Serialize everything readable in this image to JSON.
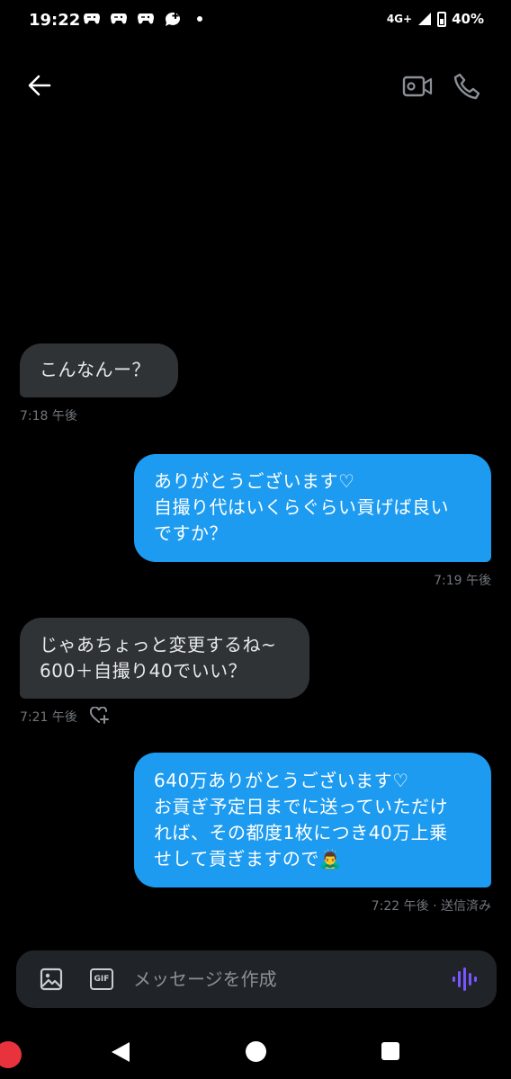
{
  "status_bar": {
    "time": "19:22",
    "network": "4G+",
    "battery": "40%"
  },
  "header": {
    "back_icon": "arrow-left-icon",
    "video_icon": "video-camera-icon",
    "call_icon": "phone-icon"
  },
  "messages": [
    {
      "direction": "incoming",
      "text": "こんなんー？",
      "meta": "7:18 午後"
    },
    {
      "direction": "outgoing",
      "text": "ありがとうございます♡\n自撮り代はいくらぐらい貢げば良い\nですか？",
      "meta": "7:19 午後"
    },
    {
      "direction": "incoming",
      "text": "じゃあちょっと変更するね~\n600＋自撮り40でいい？",
      "meta": "7:21 午後"
    },
    {
      "direction": "outgoing",
      "text": "640万ありがとうございます♡\nお貢ぎ予定日までに送っていただけ\nれば、その都度1枚につき40万上乗\nせして貢ぎますので🙇‍♂️",
      "meta": "7:22 午後 · 送信済み"
    }
  ],
  "composer": {
    "placeholder": "メッセージを作成",
    "gif_label": "GIF"
  },
  "colors": {
    "outgoing_bubble": "#1d9bf0",
    "incoming_bubble": "#2f3336",
    "background": "#000000",
    "voice_icon": "#7856ff"
  }
}
